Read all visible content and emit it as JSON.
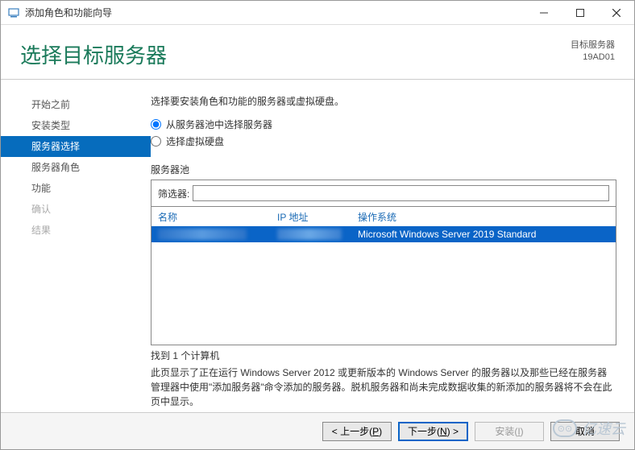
{
  "titlebar": {
    "title": "添加角色和功能向导"
  },
  "header": {
    "title": "选择目标服务器",
    "target_label": "目标服务器",
    "target_value": "19AD01"
  },
  "sidebar": {
    "items": [
      {
        "label": "开始之前",
        "state": "normal"
      },
      {
        "label": "安装类型",
        "state": "normal"
      },
      {
        "label": "服务器选择",
        "state": "selected"
      },
      {
        "label": "服务器角色",
        "state": "normal"
      },
      {
        "label": "功能",
        "state": "normal"
      },
      {
        "label": "确认",
        "state": "disabled"
      },
      {
        "label": "结果",
        "state": "disabled"
      }
    ]
  },
  "main": {
    "instruction": "选择要安装角色和功能的服务器或虚拟硬盘。",
    "radio1": "从服务器池中选择服务器",
    "radio2": "选择虚拟硬盘",
    "pool_label": "服务器池",
    "filter_label": "筛选器:",
    "columns": {
      "name": "名称",
      "ip": "IP 地址",
      "os": "操作系统"
    },
    "row": {
      "os": "Microsoft Windows Server 2019 Standard"
    },
    "found": "找到 1 个计算机",
    "help": "此页显示了正在运行 Windows Server 2012 或更新版本的 Windows Server 的服务器以及那些已经在服务器管理器中使用\"添加服务器\"命令添加的服务器。脱机服务器和尚未完成数据收集的新添加的服务器将不会在此页中显示。"
  },
  "footer": {
    "prev": "< 上一步(P)",
    "next": "下一步(N) >",
    "install": "安装(I)",
    "cancel": "取消"
  },
  "watermark": "亿速云"
}
